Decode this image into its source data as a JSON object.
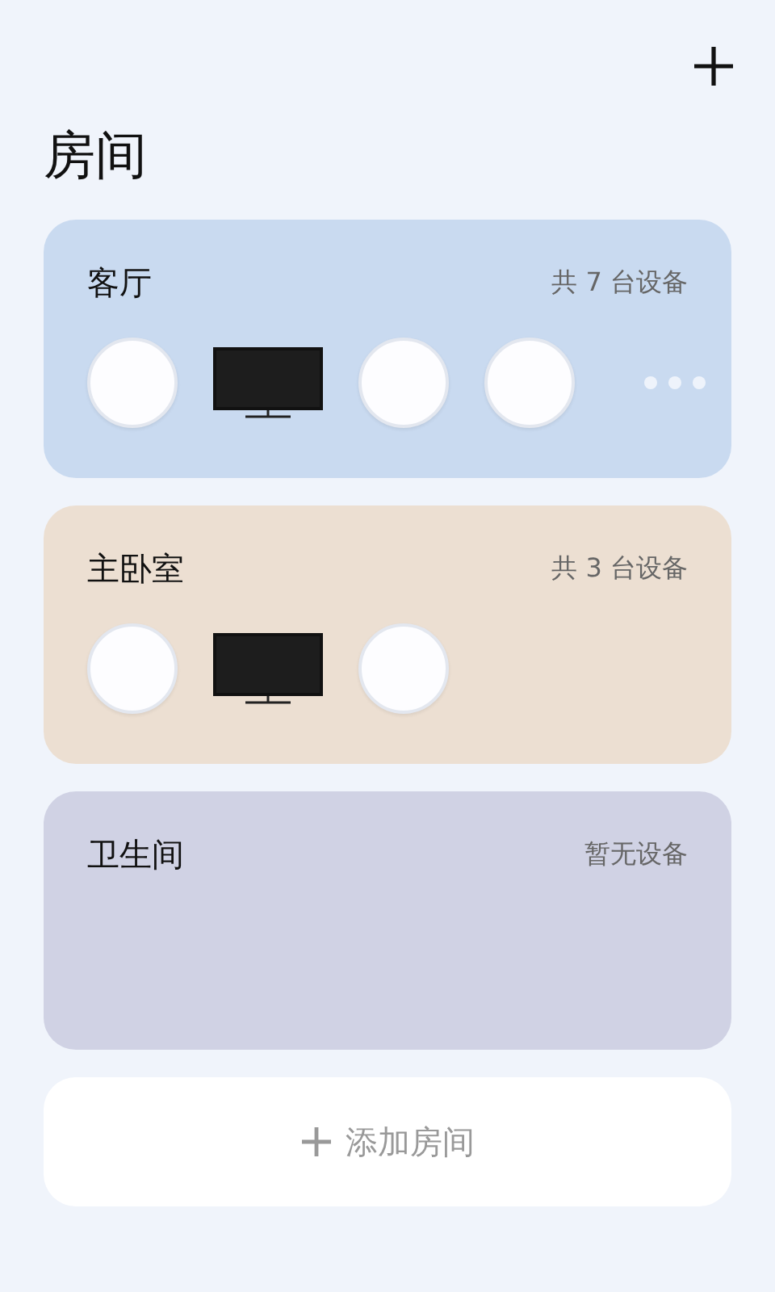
{
  "title": "房间",
  "rooms": [
    {
      "name": "客厅",
      "count": "共 7 台设备",
      "color": "#c9daf0",
      "more": true,
      "devices": [
        {
          "kind": "lamp"
        },
        {
          "kind": "tv"
        },
        {
          "kind": "lamp"
        },
        {
          "kind": "lamp"
        }
      ]
    },
    {
      "name": "主卧室",
      "count": "共 3 台设备",
      "color": "#ecdfd2",
      "more": false,
      "devices": [
        {
          "kind": "lamp"
        },
        {
          "kind": "tv"
        },
        {
          "kind": "lamp"
        }
      ]
    },
    {
      "name": "卫生间",
      "count": "暂无设备",
      "color": "#d0d2e4",
      "more": false
    }
  ],
  "add_button": {
    "label": "添加房间"
  }
}
